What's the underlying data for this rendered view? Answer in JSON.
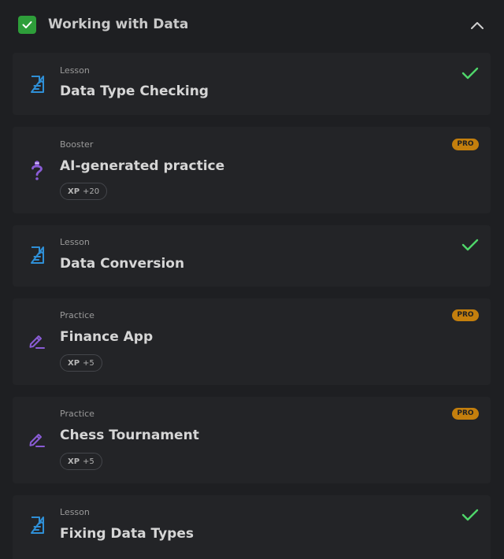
{
  "module": {
    "title": "Working with Data",
    "completed": true,
    "expanded": true
  },
  "items": [
    {
      "type_label": "Lesson",
      "title": "Data Type Checking",
      "icon": "lesson-document-icon",
      "completed": true
    },
    {
      "type_label": "Booster",
      "title": "AI-generated practice",
      "icon": "question-mark-icon",
      "badge": "PRO",
      "xp_label": "XP",
      "xp_value": "+20"
    },
    {
      "type_label": "Lesson",
      "title": "Data Conversion",
      "icon": "lesson-document-icon",
      "completed": true
    },
    {
      "type_label": "Practice",
      "title": "Finance App",
      "icon": "pencil-edit-icon",
      "badge": "PRO",
      "xp_label": "XP",
      "xp_value": "+5"
    },
    {
      "type_label": "Practice",
      "title": "Chess Tournament",
      "icon": "pencil-edit-icon",
      "badge": "PRO",
      "xp_label": "XP",
      "xp_value": "+5"
    },
    {
      "type_label": "Lesson",
      "title": "Fixing Data Types",
      "icon": "lesson-document-icon",
      "completed": true
    }
  ],
  "colors": {
    "background": "#1e1f22",
    "card": "#232427",
    "lesson_icon": "#2f8fd6",
    "practice_icon": "#8a5cd6",
    "check": "#4fd66a",
    "pro_badge": "#c47f0d",
    "module_check": "#2e9e3a"
  }
}
